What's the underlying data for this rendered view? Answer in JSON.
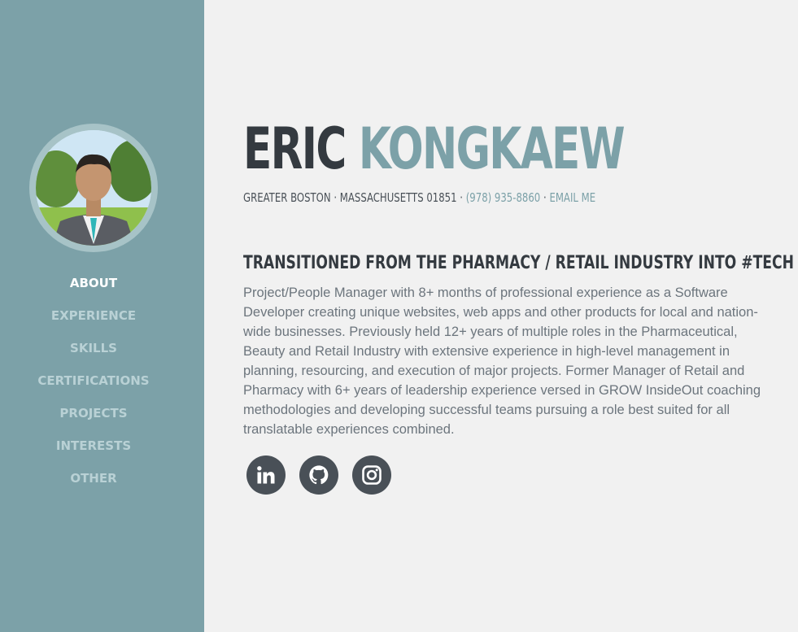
{
  "nav": {
    "items": [
      "ABOUT",
      "EXPERIENCE",
      "SKILLS",
      "CERTIFICATIONS",
      "PROJECTS",
      "INTERESTS",
      "OTHER"
    ],
    "active": "ABOUT"
  },
  "profile": {
    "first_name": "ERIC",
    "last_name": "KONGKAEW",
    "address": "GREATER BOSTON · MASSACHUSETTS 01851 ·",
    "phone": "(978) 935-8860",
    "separator": "·",
    "email_label": "EMAIL ME"
  },
  "about": {
    "headline": "TRANSITIONED FROM THE PHARMACY / RETAIL INDUSTRY INTO #TECH",
    "bio": "Project/People Manager with 8+ months of professional experience as a Software Developer creating unique websites, web apps and other products for local and nation-wide businesses. Previously held 12+ years of multiple roles in the Pharmaceutical, Beauty and Retail Industry with extensive experience in high-level management in planning, resourcing, and execution of major projects. Former Manager of Retail and Pharmacy with 6+ years of leadership experience versed in GROW InsideOut coaching methodologies and developing successful teams pursuing a role best suited for all translatable experiences combined."
  },
  "social": {
    "icons": [
      "linkedin-icon",
      "github-icon",
      "instagram-icon"
    ]
  },
  "colors": {
    "sidebar": "#7ca1a8",
    "accent": "#7ca1a8",
    "dark": "#343a40",
    "background": "#f1f1f1"
  }
}
